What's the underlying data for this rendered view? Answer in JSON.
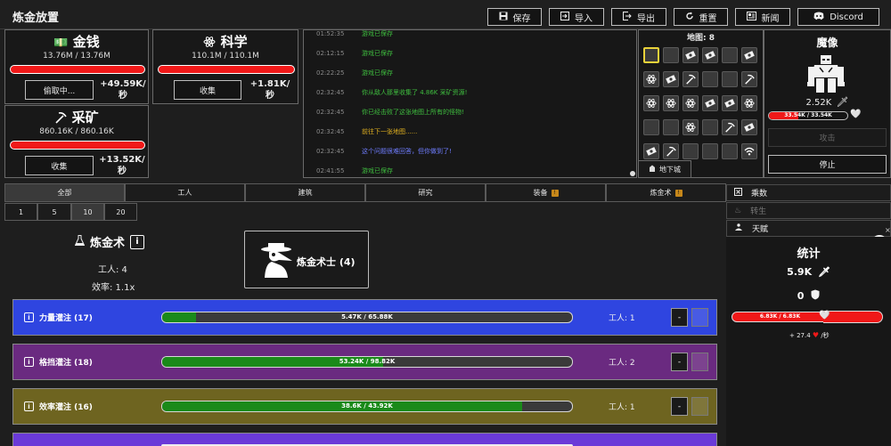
{
  "header": {
    "title": "炼金放置",
    "buttons": [
      {
        "label": "保存",
        "icon": "save-icon"
      },
      {
        "label": "导入",
        "icon": "import-icon"
      },
      {
        "label": "导出",
        "icon": "export-icon"
      },
      {
        "label": "重置",
        "icon": "reset-icon"
      },
      {
        "label": "新闻",
        "icon": "news-icon"
      },
      {
        "label": "Discord",
        "icon": "discord-icon"
      }
    ]
  },
  "resources": {
    "money": {
      "name": "金钱",
      "amount": "13.76M / 13.76M",
      "button": "偷取中...",
      "rate1": "+49.59K/",
      "rate2": "秒"
    },
    "science": {
      "name": "科学",
      "amount": "110.1M / 110.1M",
      "button": "收集",
      "rate1": "+1.81K/",
      "rate2": "秒"
    },
    "mining": {
      "name": "采矿",
      "amount": "860.16K / 860.16K",
      "button": "收集",
      "rate1": "+13.52K/",
      "rate2": "秒"
    }
  },
  "log": [
    {
      "time": "01:52:35",
      "text": "游戏已保存",
      "color": "#3fbf3f"
    },
    {
      "time": "02:12:15",
      "text": "游戏已保存",
      "color": "#3fbf3f"
    },
    {
      "time": "02:22:25",
      "text": "游戏已保存",
      "color": "#3fbf3f"
    },
    {
      "time": "02:32:45",
      "text": "你从敌人那里收集了 4.86K 采矿资源!",
      "color": "#3fbf3f"
    },
    {
      "time": "02:32:45",
      "text": "你已经击败了这张地图上所有的怪物!",
      "color": "#3fbf3f"
    },
    {
      "time": "02:32:45",
      "text": "前往下一张地图......",
      "color": "#e0b020"
    },
    {
      "time": "02:32:45",
      "text": "这个问题很难回答，但你做到了!",
      "color": "#6f7dff"
    },
    {
      "time": "02:41:55",
      "text": "游戏已保存",
      "color": "#3fbf3f"
    }
  ],
  "map": {
    "label": "地图: 8",
    "cells": [
      "",
      "",
      "money",
      "money",
      "",
      "money",
      "science",
      "money",
      "pick",
      "",
      "",
      "pick",
      "science",
      "science",
      "science",
      "money",
      "money",
      "science",
      "",
      "",
      "science",
      "",
      "pick",
      "money",
      "money",
      "pick",
      "",
      "",
      "",
      "wifi"
    ],
    "dungeon_tab": "地下城"
  },
  "enemy": {
    "name": "魔像",
    "attack": "2.52K",
    "hp_text": "33.54K / 33.54K",
    "hp_fraction": 0.38,
    "attack_button": "攻击",
    "stop_button": "停止"
  },
  "tabs": [
    {
      "label": "全部",
      "badge": ""
    },
    {
      "label": "工人",
      "badge": ""
    },
    {
      "label": "建筑",
      "badge": ""
    },
    {
      "label": "研究",
      "badge": ""
    },
    {
      "label": "装备",
      "badge": "!"
    },
    {
      "label": "炼金术",
      "badge": "!"
    }
  ],
  "quantities": [
    "1",
    "5",
    "10",
    "20"
  ],
  "job": {
    "title": "炼金术",
    "workers": "工人: 4",
    "efficiency": "效率: 1.1x",
    "hire_label": "炼金术士 (4)"
  },
  "upgrades": [
    {
      "name": "力量灌注 (17)",
      "progress_text": "5.47K / 65.88K",
      "fraction": 0.083,
      "workers": "工人: 1",
      "bg": "#2f45e0"
    },
    {
      "name": "格挡灌注 (18)",
      "progress_text": "53.24K / 98.82K",
      "fraction": 0.539,
      "workers": "工人: 2",
      "bg": "#6a2a80"
    },
    {
      "name": "效率灌注 (16)",
      "progress_text": "38.6K / 43.92K",
      "fraction": 0.879,
      "workers": "工人: 1",
      "bg": "#6e6420"
    }
  ],
  "minus_label": "-",
  "sidebar": {
    "prestige": "乘数",
    "rebirth": "转生",
    "talent": "天赋",
    "stats_title": "统计",
    "attack": "5.9K",
    "defense": "0",
    "hp_text": "6.83K / 6.83K",
    "regen": "+ 27.4",
    "regen_unit": "/秒"
  }
}
